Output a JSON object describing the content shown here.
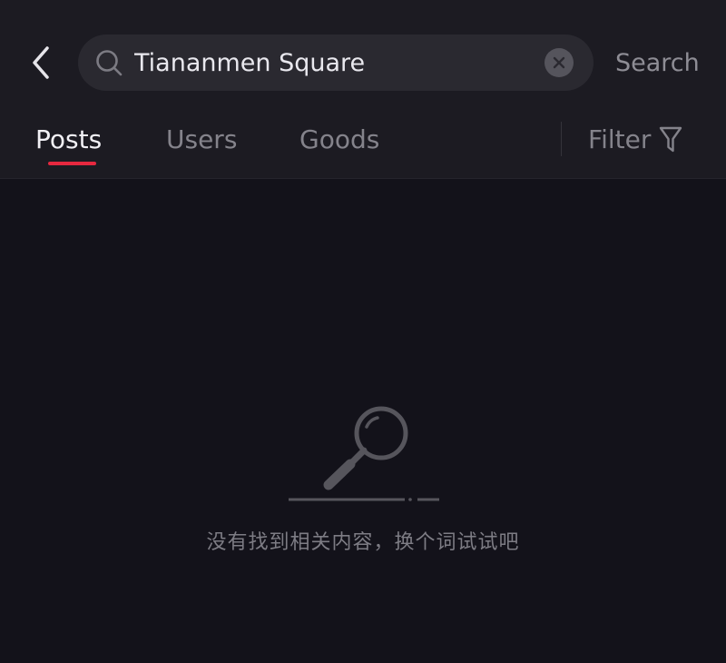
{
  "search": {
    "query": "Tiananmen Square",
    "action_label": "Search"
  },
  "tabs": [
    {
      "label": "Posts",
      "active": true
    },
    {
      "label": "Users",
      "active": false
    },
    {
      "label": "Goods",
      "active": false
    }
  ],
  "filter": {
    "label": "Filter"
  },
  "empty_state": {
    "message": "没有找到相关内容，换个词试试吧",
    "icon": "magnifier-icon"
  },
  "colors": {
    "background": "#13121a",
    "header": "#1c1b22",
    "accent": "#e6283f",
    "active_text": "#f1f0f5",
    "inactive_text": "#84838b"
  }
}
